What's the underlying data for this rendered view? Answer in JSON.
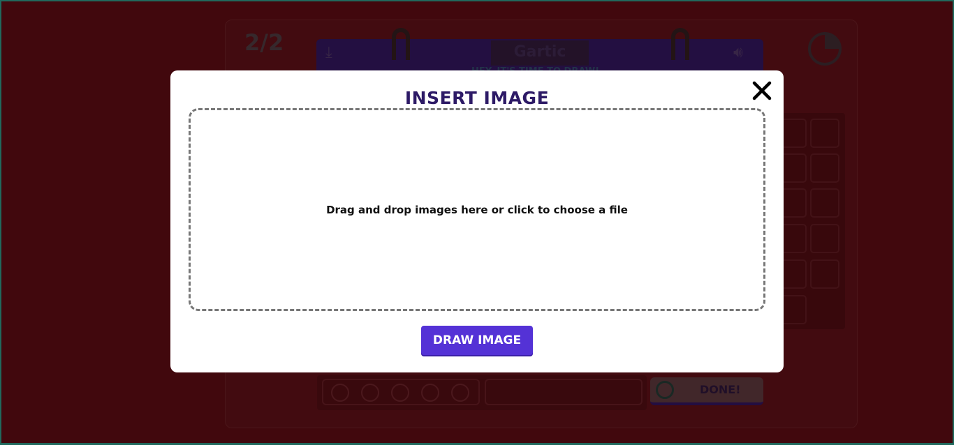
{
  "background": {
    "round_counter": "2/2",
    "logo_text": "Gartic",
    "hint_text": "HEY, IT'S TIME TO DRAW!",
    "done_label": "DONE!"
  },
  "modal": {
    "title": "INSERT IMAGE",
    "dropzone_text": "Drag and drop images here or click to choose a file",
    "draw_button_label": "DRAW IMAGE",
    "close_icon": "close-icon"
  },
  "colors": {
    "accent": "#5432d6",
    "title": "#2d1a66",
    "backdrop": "#4a0a10"
  }
}
